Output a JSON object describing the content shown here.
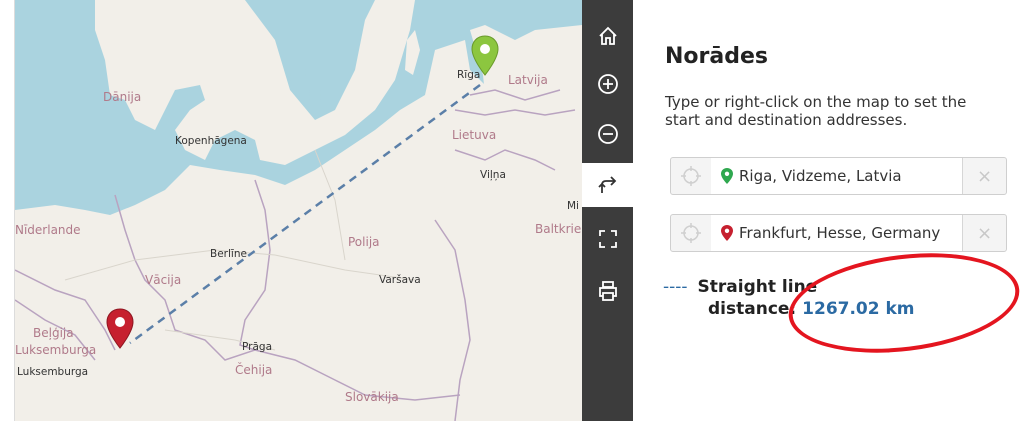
{
  "map": {
    "countries": [
      "Dānija",
      "Latvija",
      "Lietuva",
      "Polija",
      "Vācija",
      "Čehija",
      "Slovākija",
      "Beļģija",
      "Luksemburga",
      "Baltkrie",
      "Nīderlande"
    ],
    "cities": [
      "Rīga",
      "Kopenhāgena",
      "Viļņa",
      "Berlīne",
      "Varšava",
      "Prāga",
      "Luksemburga",
      "Mi"
    ],
    "line_color": "#5b7fa8",
    "start_pin_color": "#8cc63f",
    "end_pin_color": "#c6202f"
  },
  "toolbar": {
    "items": [
      "home-icon",
      "zoom-in-icon",
      "zoom-out-icon",
      "directions-icon",
      "fullscreen-icon",
      "print-icon"
    ],
    "active": "directions-icon"
  },
  "panel": {
    "title": "Norādes",
    "description": "Type or right-click on the map to set the start and destination addresses.",
    "start": {
      "value": "Riga, Vidzeme, Latvia",
      "pin_color": "#2fa84f"
    },
    "destination": {
      "value": "Frankfurt, Hesse, Germany",
      "pin_color": "#c6202f"
    },
    "clear_label": "×",
    "legend_dash": "----",
    "distance_label_1": "Straight line",
    "distance_label_2": "distance:",
    "distance_value": "1267.02 km"
  },
  "annotation": {
    "highlight_color": "#e4151f"
  }
}
